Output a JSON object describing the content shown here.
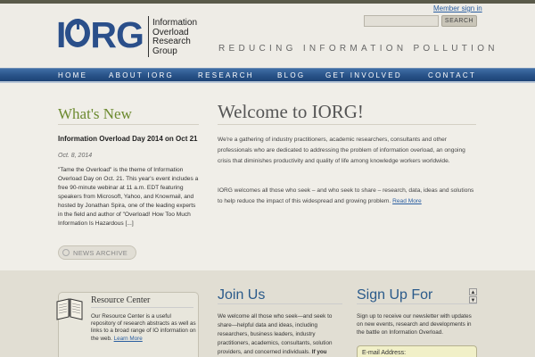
{
  "header": {
    "logo_main": "I",
    "logo_main_rest": "RG",
    "logo_lines": [
      "Information",
      "Overload",
      "Research",
      "Group"
    ],
    "member_signin": "Member sign in",
    "search_button": "SEARCH",
    "tagline": "Reducing Information Pollution"
  },
  "nav": {
    "items": [
      {
        "label": "HOME"
      },
      {
        "label": "ABOUT IORG"
      },
      {
        "label": "RESEARCH"
      },
      {
        "label": "BLOG"
      },
      {
        "label": "GET INVOLVED"
      },
      {
        "label": "CONTACT"
      }
    ]
  },
  "whats_new": {
    "heading": "What's New",
    "news_title": "Information Overload Day 2014 on Oct 21",
    "news_date": "Oct. 8, 2014",
    "news_body": "\"Tame the Overload\" is the theme of Information Overload Day on Oct. 21. This year's event includes a free 90-minute webinar at 11 a.m. EDT featuring speakers from Microsoft, Yahoo, and Knowmail, and hosted by Jonathan Spira, one of the leading experts in the field and author of \"Overload! How Too Much Information Is Hazardous [...]",
    "archive_button": "NEWS ARCHIVE"
  },
  "welcome": {
    "heading": "Welcome to IORG!",
    "p1": "We're a gathering of industry practitioners, academic researchers, consultants and other professionals who are dedicated to addressing the problem of information overload, an ongoing crisis that diminishes productivity and quality of life among knowledge workers worldwide.",
    "p2": "IORG welcomes all those who seek – and who seek to share – research, data, ideas and solutions to help reduce the impact of this widespread and growing problem.",
    "read_more": "Read More"
  },
  "resource_center": {
    "title": "Resource Center",
    "text": "Our Resource Center is a useful repository of research abstracts as well as links to a broad range of IO information on the web.",
    "link": "Learn More"
  },
  "join_us": {
    "heading": "Join Us",
    "text": "We welcome all those who seek—and seek to share—helpful data and ideas, including researchers, business leaders, industry practitioners, academics, consultants, solution providers, and concerned individuals.",
    "text_bold": "If you"
  },
  "signup": {
    "heading": "Sign Up For",
    "text": "Sign up to receive our newsletter with updates on new events, research and developments in the battle on Information Overload.",
    "email_label": "E-mail Address:"
  },
  "colors": {
    "brand_blue": "#2a4f8a",
    "nav_blue": "#285288",
    "accent_green": "#6c8a2f",
    "link_blue": "#2a5ea0"
  }
}
